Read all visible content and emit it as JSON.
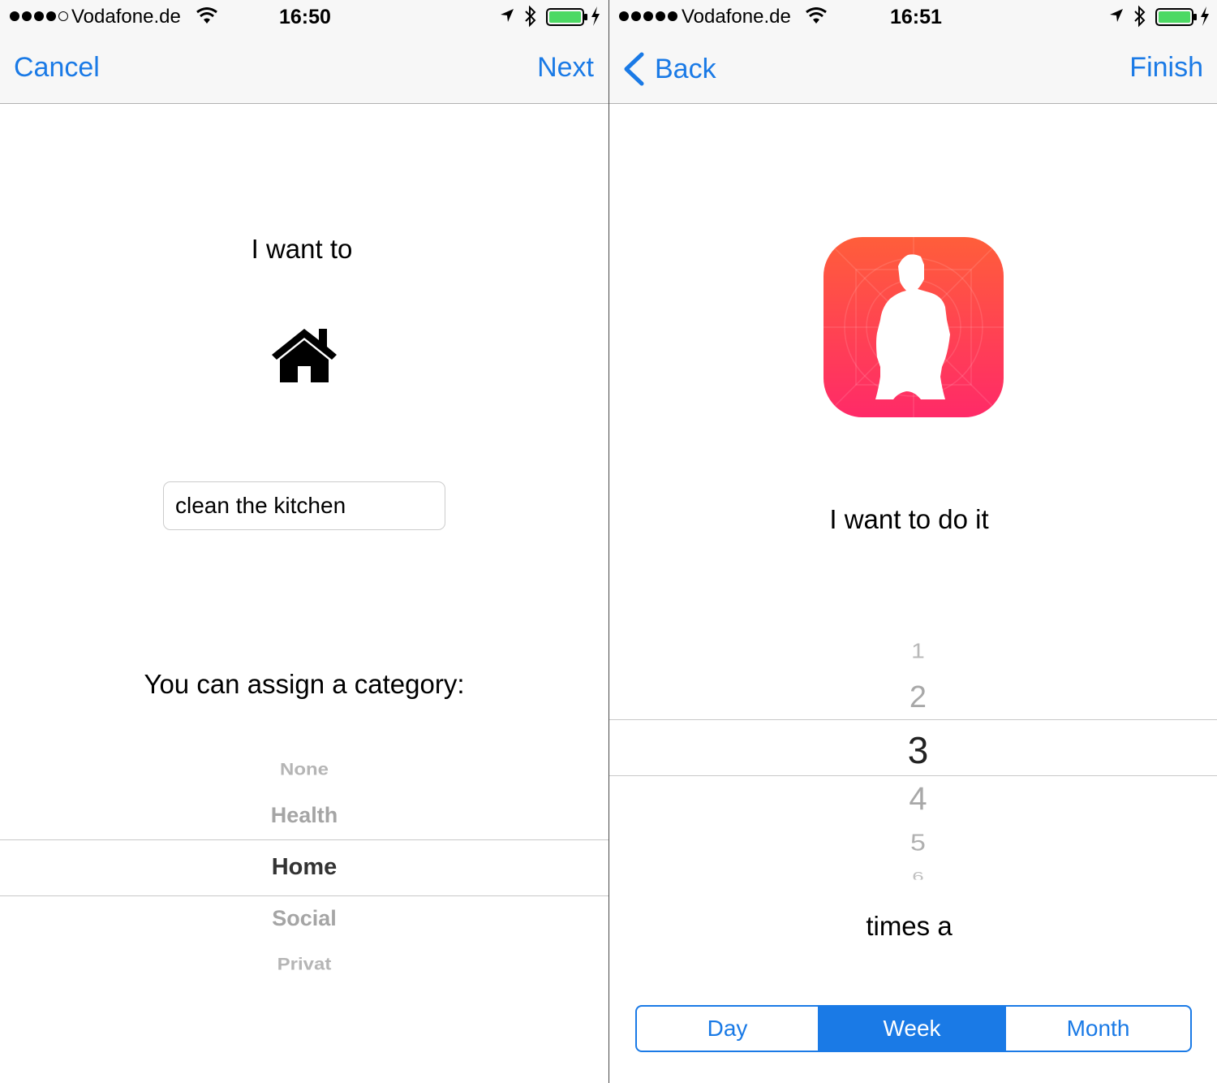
{
  "left": {
    "status": {
      "carrier": "Vodafone.de",
      "time": "16:50"
    },
    "nav": {
      "left": "Cancel",
      "right": "Next"
    },
    "prompt": "I want to",
    "icon": "house-icon",
    "task_value": "clean the kitchen",
    "category_prompt": "You can assign a category:",
    "categories": [
      "None",
      "Health",
      "Home",
      "Social",
      "Privat"
    ],
    "selected_category": "Home"
  },
  "right": {
    "status": {
      "carrier": "Vodafone.de",
      "time": "16:51"
    },
    "nav": {
      "left": "Back",
      "right": "Finish"
    },
    "app_icon": "person-silhouette-app-icon",
    "prompt": "I want to do it",
    "numbers": [
      "1",
      "2",
      "3",
      "4",
      "5",
      "6"
    ],
    "selected_number": "3",
    "times_label": "times a",
    "segments": [
      "Day",
      "Week",
      "Month"
    ],
    "selected_segment": "Week"
  },
  "colors": {
    "tint": "#1a7ae6",
    "battery": "#4cd964",
    "app_icon_top": "#ff5e3a",
    "app_icon_bottom": "#ff2a68"
  }
}
